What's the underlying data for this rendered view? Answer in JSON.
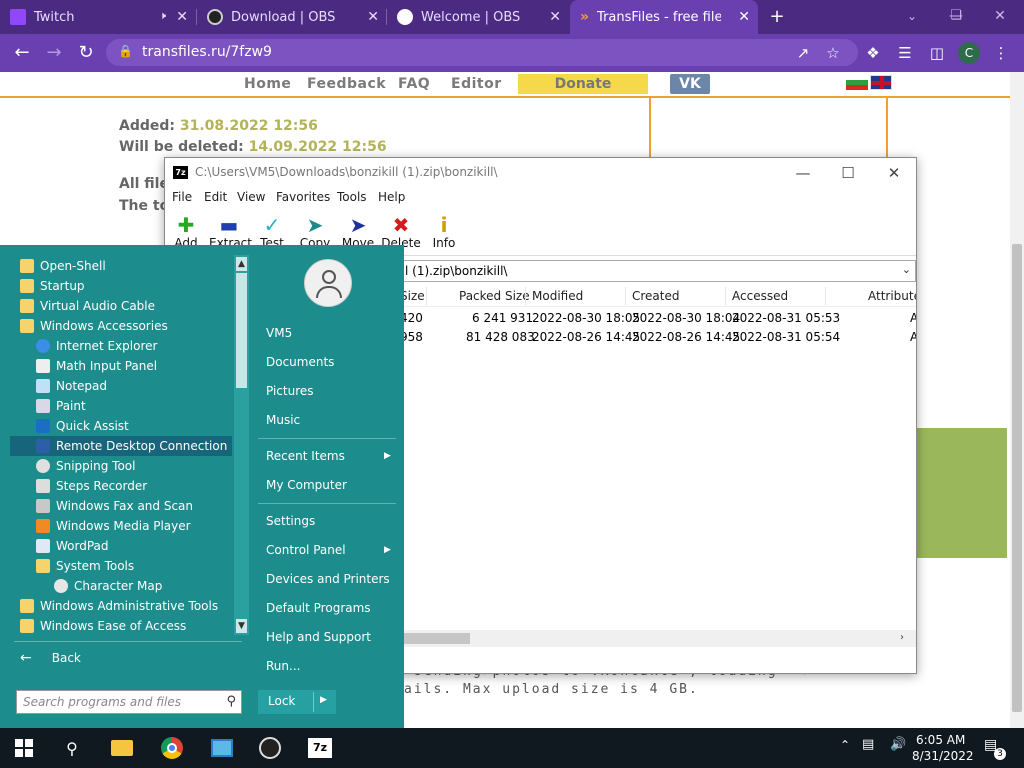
{
  "browser": {
    "tabs": [
      {
        "title": "Twitch",
        "favicon": "twitch-icon",
        "color": "#9146ff"
      },
      {
        "title": "Download | OBS",
        "favicon": "obs-icon",
        "color": "#222222"
      },
      {
        "title": "Welcome | OBS",
        "favicon": "globe-icon",
        "color": "#ffffff"
      },
      {
        "title": "TransFiles - free file sha",
        "favicon": "transfiles-icon",
        "color": "#f0a030"
      }
    ],
    "url": "transfiles.ru/7fzw9",
    "profile_initial": "C",
    "accent": "#6a3fb0"
  },
  "site": {
    "nav": [
      "Home",
      "Feedback",
      "FAQ",
      "Editor"
    ],
    "donate": "Donate",
    "vk": "VK",
    "added_label": "Added:",
    "added_value": "31.08.2022 12:56",
    "deleted_label": "Will be deleted:",
    "deleted_value": "14.09.2022 12:56",
    "partial1": "All file",
    "partial2": "The to",
    "mono1": "sending photos to VKontakte , loading",
    "mono2": "ails. Max upload size is 4 GB."
  },
  "sevenzip": {
    "title": "C:\\Users\\VM5\\Downloads\\bonzikill (1).zip\\bonzikill\\",
    "menu": [
      "File",
      "Edit",
      "View",
      "Favorites",
      "Tools",
      "Help"
    ],
    "tools": [
      {
        "label": "Add",
        "icon": "add-icon",
        "color": "#22aa22"
      },
      {
        "label": "Extract",
        "icon": "extract-icon",
        "color": "#1f3fae"
      },
      {
        "label": "Test",
        "icon": "test-icon",
        "color": "#1fb2c6"
      },
      {
        "label": "Copy",
        "icon": "copy-icon",
        "color": "#1a8a8a"
      },
      {
        "label": "Move",
        "icon": "move-icon",
        "color": "#1f2f9e"
      },
      {
        "label": "Delete",
        "icon": "delete-icon",
        "color": "#d41c1c"
      },
      {
        "label": "Info",
        "icon": "info-icon",
        "color": "#c8a000"
      }
    ],
    "address": "l (1).zip\\bonzikill\\",
    "columns": [
      "Size",
      "Packed Size",
      "Modified",
      "Created",
      "Accessed",
      "Attribute"
    ],
    "rows": [
      {
        "size": "420",
        "packed": "6 241 931",
        "modified": "2022-08-30 18:05",
        "created": "2022-08-30 18:04",
        "accessed": "2022-08-31 05:53",
        "attr": "A"
      },
      {
        "size": "958",
        "packed": "81 428 083",
        "modified": "2022-08-26 14:45",
        "created": "2022-08-26 14:45",
        "accessed": "2022-08-31 05:54",
        "attr": "A"
      }
    ]
  },
  "startmenu": {
    "programs": [
      {
        "label": "Open-Shell",
        "indent": 0,
        "icon": "folder-icon"
      },
      {
        "label": "Startup",
        "indent": 0,
        "icon": "folder-icon"
      },
      {
        "label": "Virtual Audio Cable",
        "indent": 0,
        "icon": "folder-icon"
      },
      {
        "label": "Windows Accessories",
        "indent": 0,
        "icon": "folder-icon"
      },
      {
        "label": "Internet Explorer",
        "indent": 1,
        "icon": "internet-explorer-icon"
      },
      {
        "label": "Math Input Panel",
        "indent": 1,
        "icon": "math-input-icon"
      },
      {
        "label": "Notepad",
        "indent": 1,
        "icon": "notepad-icon"
      },
      {
        "label": "Paint",
        "indent": 1,
        "icon": "paint-icon"
      },
      {
        "label": "Quick Assist",
        "indent": 1,
        "icon": "quick-assist-icon"
      },
      {
        "label": "Remote Desktop Connection",
        "indent": 1,
        "icon": "remote-desktop-icon",
        "selected": true
      },
      {
        "label": "Snipping Tool",
        "indent": 1,
        "icon": "snipping-tool-icon"
      },
      {
        "label": "Steps Recorder",
        "indent": 1,
        "icon": "steps-recorder-icon"
      },
      {
        "label": "Windows Fax and Scan",
        "indent": 1,
        "icon": "fax-scan-icon"
      },
      {
        "label": "Windows Media Player",
        "indent": 1,
        "icon": "media-player-icon"
      },
      {
        "label": "WordPad",
        "indent": 1,
        "icon": "wordpad-icon"
      },
      {
        "label": "System Tools",
        "indent": 1,
        "icon": "folder-icon"
      },
      {
        "label": "Character Map",
        "indent": 2,
        "icon": "character-map-icon"
      },
      {
        "label": "Windows Administrative Tools",
        "indent": 0,
        "icon": "folder-icon"
      },
      {
        "label": "Windows Ease of Access",
        "indent": 0,
        "icon": "folder-icon"
      }
    ],
    "back": "Back",
    "search_placeholder": "Search programs and files",
    "user": "VM5",
    "right_items": [
      {
        "label": "Documents"
      },
      {
        "label": "Pictures"
      },
      {
        "label": "Music"
      },
      {
        "label": "Recent Items",
        "arrow": true
      },
      {
        "label": "My Computer"
      },
      {
        "label": "Settings"
      },
      {
        "label": "Control Panel",
        "arrow": true
      },
      {
        "label": "Devices and Printers"
      },
      {
        "label": "Default Programs"
      },
      {
        "label": "Help and Support"
      },
      {
        "label": "Run..."
      }
    ],
    "lock": "Lock",
    "bg_color": "#1c8c8c"
  },
  "taskbar": {
    "time": "6:05 AM",
    "date": "8/31/2022",
    "notifications": "3",
    "apps": [
      "windows-start-icon",
      "search-icon",
      "file-explorer-icon",
      "chrome-icon",
      "control-panel-icon",
      "obs-icon",
      "7zip-icon"
    ]
  }
}
